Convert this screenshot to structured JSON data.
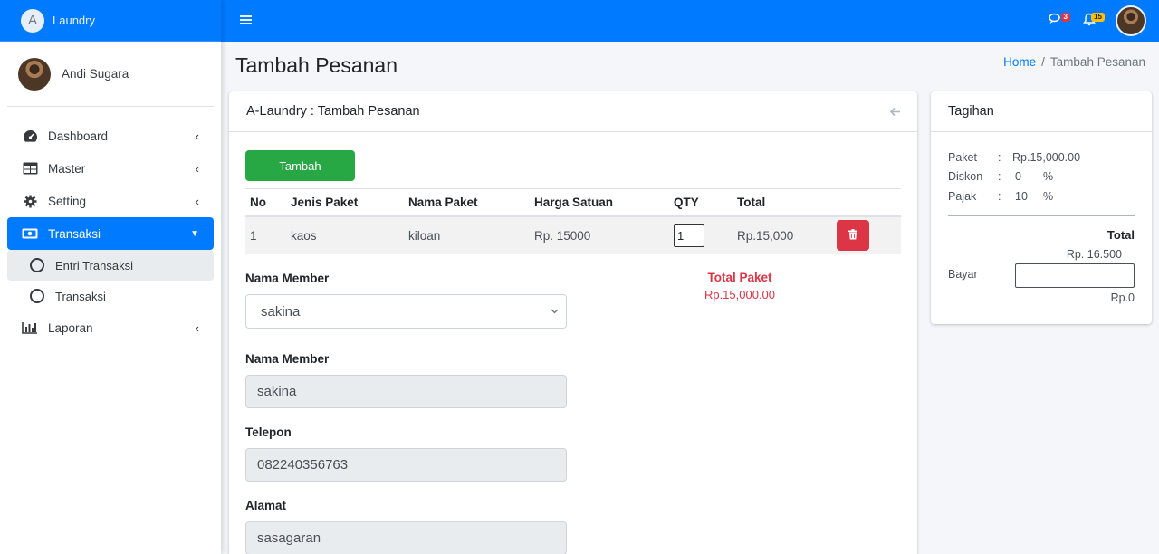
{
  "brand": {
    "logo_letter": "A",
    "name": "Laundry"
  },
  "user": {
    "name": "Andi Sugara"
  },
  "nav": {
    "dashboard": "Dashboard",
    "master": "Master",
    "setting": "Setting",
    "transaksi": "Transaksi",
    "entri": "Entri Transaksi",
    "transaksi_sub": "Transaksi",
    "laporan": "Laporan"
  },
  "topbar": {
    "chat_badge": "3",
    "notif_badge": "15"
  },
  "header": {
    "title": "Tambah Pesanan",
    "breadcrumb_home": "Home",
    "breadcrumb_sep": "/",
    "breadcrumb_current": "Tambah Pesanan"
  },
  "main": {
    "card_title": "A-Laundry : Tambah Pesanan",
    "add_button": "Tambah",
    "table": {
      "columns": [
        "No",
        "Jenis Paket",
        "Nama Paket",
        "Harga Satuan",
        "QTY",
        "Total"
      ],
      "rows": [
        {
          "no": "1",
          "jenis": "kaos",
          "nama": "kiloan",
          "harga": "Rp. 15000",
          "qty": "1",
          "total": "Rp.15,000"
        }
      ]
    },
    "member_select_label": "Nama Member",
    "member_select_value": "sakina",
    "total_paket_label": "Total Paket",
    "total_paket_value": "Rp.15,000.00",
    "member_label": "Nama Member",
    "member_value": "sakina",
    "telepon_label": "Telepon",
    "telepon_value": "082240356763",
    "alamat_label": "Alamat",
    "alamat_value": "sasagaran"
  },
  "bill": {
    "title": "Tagihan",
    "paket_label": "Paket",
    "paket_value": "Rp.15,000.00",
    "diskon_label": "Diskon",
    "diskon_value": "0",
    "diskon_unit": "%",
    "pajak_label": "Pajak",
    "pajak_value": "10",
    "pajak_unit": "%",
    "colon": ":",
    "total_label": "Total",
    "total_value": "Rp. 16.500",
    "bayar_label": "Bayar",
    "kembali_value": "Rp.0"
  },
  "colors": {
    "primary": "#007bff",
    "success": "#28a745",
    "danger": "#dc3545"
  }
}
